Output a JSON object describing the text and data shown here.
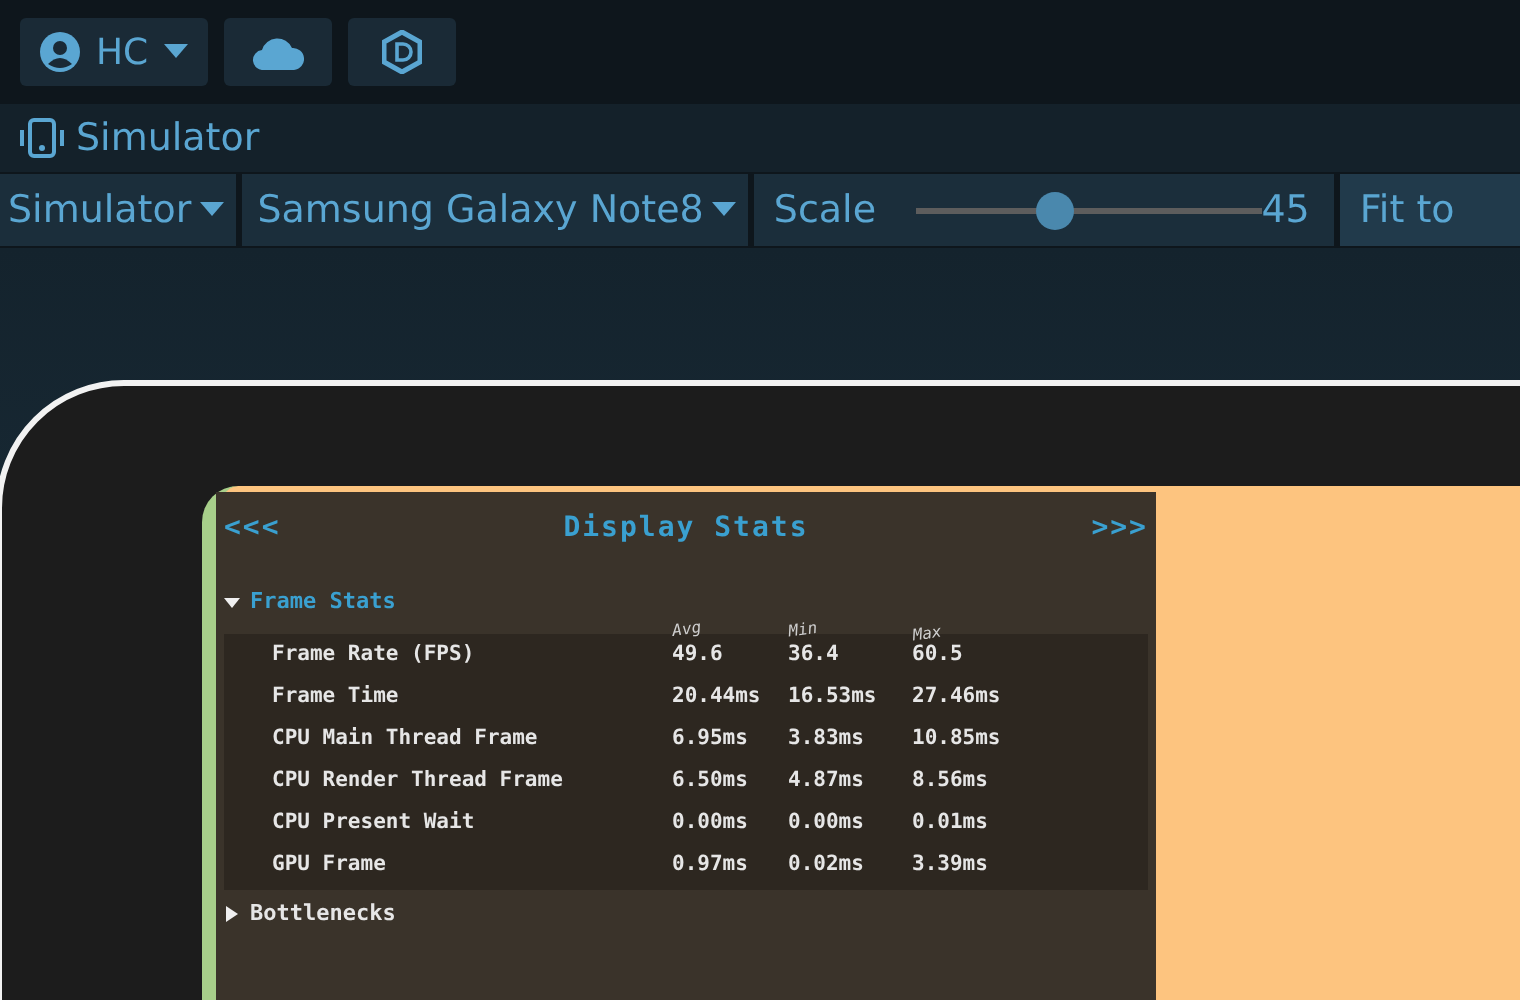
{
  "account": {
    "initials": "HC"
  },
  "panel": {
    "title": "Simulator"
  },
  "toolbar": {
    "mode": "Simulator",
    "device": "Samsung Galaxy Note8",
    "scale_label": "Scale",
    "scale": {
      "level": 0.4
    },
    "scale_value": "45",
    "fit_button": "Fit to"
  },
  "stats": {
    "prev": "<<<",
    "title": "Display Stats",
    "next": ">>>",
    "section": {
      "label": "Frame Stats",
      "expanded": true
    },
    "columns": [
      "Avg",
      "Min",
      "Max"
    ],
    "rows": [
      {
        "name": "Frame Rate (FPS)",
        "avg": "49.6",
        "min": "36.4",
        "max": "60.5"
      },
      {
        "name": "Frame Time",
        "avg": "20.44ms",
        "min": "16.53ms",
        "max": "27.46ms"
      },
      {
        "name": "CPU Main Thread Frame",
        "avg": "6.95ms",
        "min": "3.83ms",
        "max": "10.85ms"
      },
      {
        "name": "CPU Render Thread Frame",
        "avg": "6.50ms",
        "min": "4.87ms",
        "max": "8.56ms"
      },
      {
        "name": "CPU Present Wait",
        "avg": "0.00ms",
        "min": "0.00ms",
        "max": "0.01ms"
      },
      {
        "name": "GPU Frame",
        "avg": "0.97ms",
        "min": "0.02ms",
        "max": "3.39ms"
      }
    ],
    "collapsed_section": {
      "label": "Bottlenecks",
      "expanded": false
    }
  }
}
